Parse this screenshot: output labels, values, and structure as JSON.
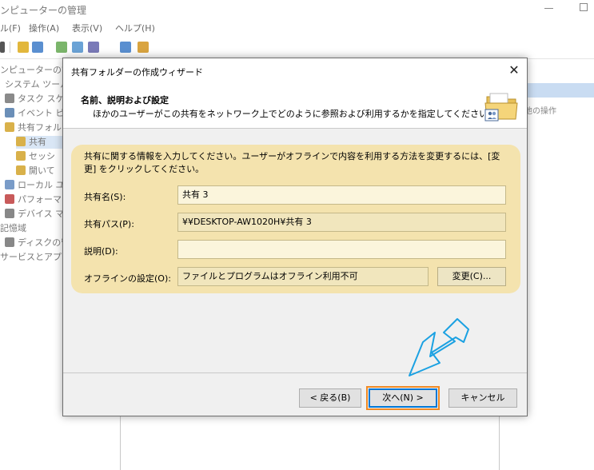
{
  "background_window": {
    "title": "ンピューターの管理",
    "menu": [
      "ル(F)",
      "操作(A)",
      "表示(V)",
      "ヘルプ(H)"
    ],
    "tree": [
      "ンピューターの管理",
      "システム ツール",
      "タスク スケ",
      "イベント ビ",
      "共有フォル",
      "共有",
      "セッシ",
      "開いて",
      "ローカル ユ",
      "パフォーマン",
      "デバイス マ",
      "記憶域",
      "ディスクの管",
      "サービスとアプリ"
    ],
    "right_pane_text": "他の操作"
  },
  "dialog": {
    "title": "共有フォルダーの作成ウィザード",
    "close_glyph": "✕",
    "header_title": "名前、説明および設定",
    "header_subtitle": "ほかのユーザーがこの共有をネットワーク上でどのように参照および利用するかを指定してください。",
    "panel_description": "共有に関する情報を入力してください。ユーザーがオフラインで内容を利用する方法を変更するには、[変更] をクリックしてください。",
    "fields": {
      "share_name_label": "共有名(S):",
      "share_name_value": "共有 3",
      "share_path_label": "共有パス(P):",
      "share_path_value": "¥¥DESKTOP-AW1020H¥共有 3",
      "description_label": "説明(D):",
      "description_value": "",
      "offline_label": "オフラインの設定(O):",
      "offline_value": "ファイルとプログラムはオフライン利用不可"
    },
    "change_button": "変更(C)...",
    "back_button": "< 戻る(B)",
    "next_button": "次へ(N) >",
    "cancel_button": "キャンセル"
  },
  "colors": {
    "panel_bg": "#f4e3ae",
    "highlight": "#f08a24",
    "arrow": "#1ba1e2",
    "focus": "#0078d7"
  }
}
